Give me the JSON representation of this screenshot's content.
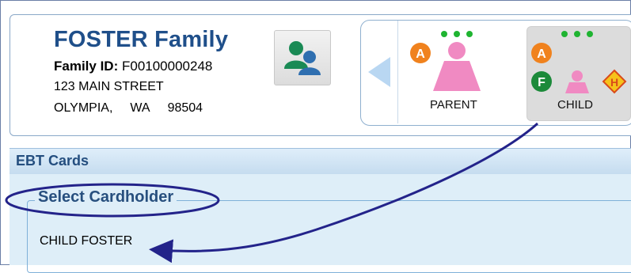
{
  "family": {
    "name": "FOSTER Family",
    "id_label": "Family ID:",
    "id_value": "F00100000248",
    "street": "123 MAIN STREET",
    "city": "OLYMPIA,",
    "state": "WA",
    "zip": "98504"
  },
  "members": [
    {
      "label": "PARENT",
      "badges": [
        "A"
      ]
    },
    {
      "label": "CHILD",
      "badges": [
        "A",
        "F",
        "H"
      ]
    }
  ],
  "ebt": {
    "section_title": "EBT Cards",
    "legend": "Select Cardholder",
    "selected_cardholder": "CHILD FOSTER"
  },
  "colors": {
    "title_blue": "#1f4f8a",
    "badge_orange": "#f0821e",
    "badge_green": "#1c8a3a",
    "badge_yellow": "#f6c21a",
    "annotation": "#23238a",
    "person_pink": "#f08ac2"
  },
  "icons": [
    "users-icon",
    "back-arrow-icon",
    "person-female-icon",
    "status-dots-icon"
  ]
}
